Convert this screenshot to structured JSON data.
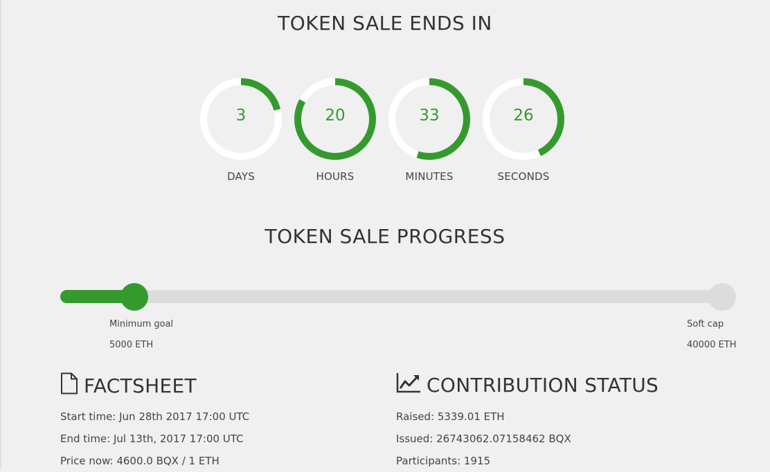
{
  "countdown": {
    "title": "TOKEN SALE ENDS IN",
    "accent_color": "#359a2e",
    "track_color": "#ffffff",
    "units": [
      {
        "value": "3",
        "label": "DAYS",
        "fraction": 0.21
      },
      {
        "value": "20",
        "label": "HOURS",
        "fraction": 0.83
      },
      {
        "value": "33",
        "label": "MINUTES",
        "fraction": 0.55
      },
      {
        "value": "26",
        "label": "SECONDS",
        "fraction": 0.43
      }
    ]
  },
  "progress": {
    "title": "TOKEN SALE PROGRESS",
    "fill_fraction": 0.11,
    "min_goal": {
      "label": "Minimum goal",
      "value": "5000 ETH"
    },
    "soft_cap": {
      "label": "Soft cap",
      "value": "40000 ETH"
    }
  },
  "factsheet": {
    "title": "FACTSHEET",
    "icon": "document-icon",
    "lines": [
      "Start time: Jun 28th 2017 17:00 UTC",
      "End time: Jul 13th, 2017 17:00 UTC",
      "Price now: 4600.0 BQX / 1 ETH"
    ]
  },
  "contribution": {
    "title": "CONTRIBUTION STATUS",
    "icon": "line-chart-icon",
    "lines": [
      "Raised: 5339.01 ETH",
      "Issued: 26743062.07158462 BQX",
      "Participants: 1915"
    ]
  }
}
